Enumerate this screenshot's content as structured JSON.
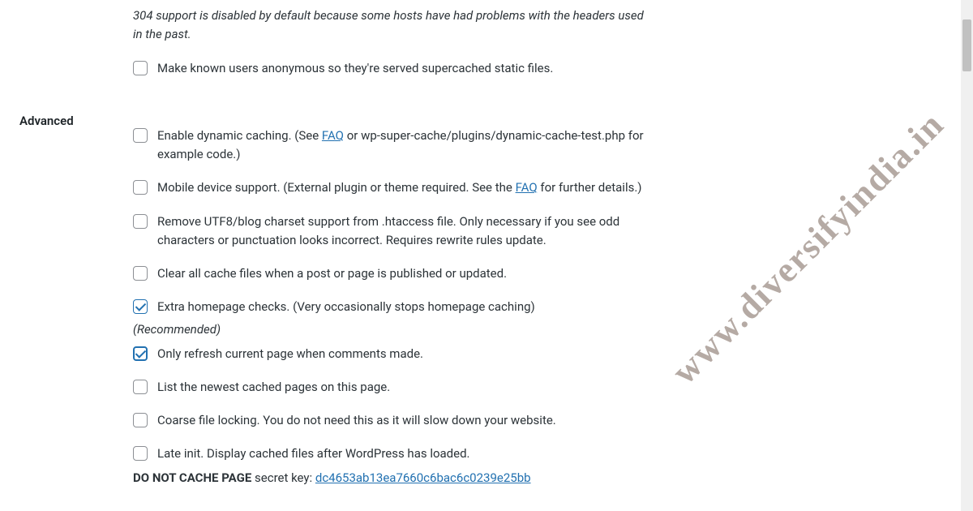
{
  "watermark": "www.diversifyindia.in",
  "note_304": "304 support is disabled by default because some hosts have had problems with the headers used in the past.",
  "section_label": "Advanced",
  "options": {
    "anon": "Make known users anonymous so they're served supercached static files.",
    "dynamic_pre": "Enable dynamic caching. (See ",
    "dynamic_link": "FAQ",
    "dynamic_post": " or wp-super-cache/plugins/dynamic-cache-test.php for example code.)",
    "mobile_pre": "Mobile device support. (External plugin or theme required. See the ",
    "mobile_link": "FAQ",
    "mobile_post": " for further details.)",
    "utf8": "Remove UTF8/blog charset support from .htaccess file. Only necessary if you see odd characters or punctuation looks incorrect. Requires rewrite rules update.",
    "clear": "Clear all cache files when a post or page is published or updated.",
    "homepage": "Extra homepage checks. (Very occasionally stops homepage caching)",
    "recommended": "(Recommended)",
    "refresh": "Only refresh current page when comments made.",
    "newest": "List the newest cached pages on this page.",
    "coarse": "Coarse file locking. You do not need this as it will slow down your website.",
    "lateinit": "Late init. Display cached files after WordPress has loaded.",
    "secret_label": "DO NOT CACHE PAGE",
    "secret_mid": " secret key: ",
    "secret_key": "dc4653ab13ea7660c6bac6c0239e25bb"
  }
}
